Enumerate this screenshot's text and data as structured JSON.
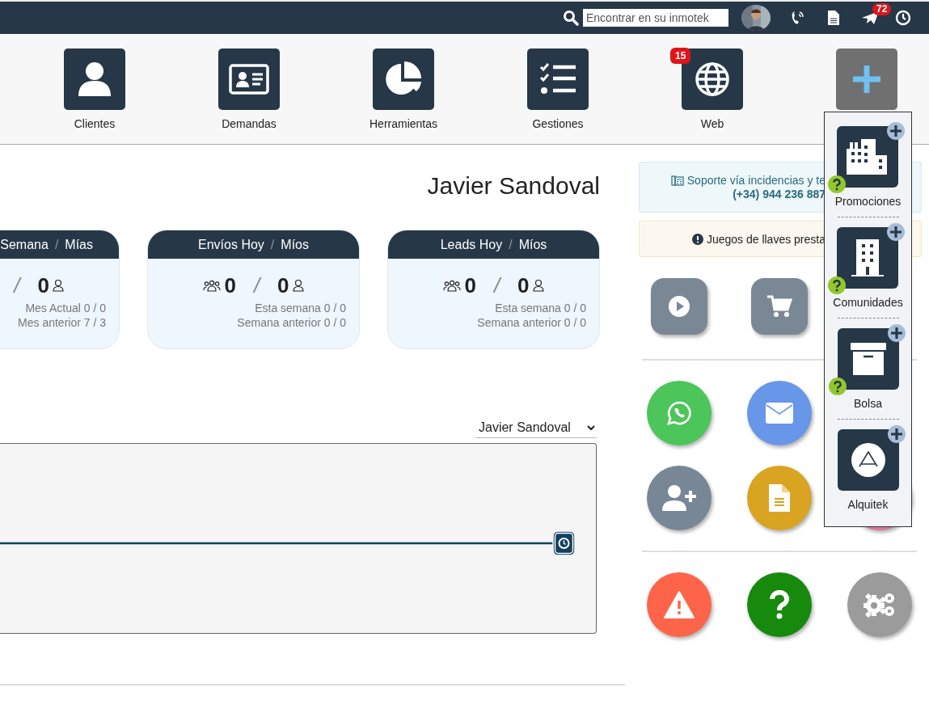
{
  "top_bar": {
    "search": {
      "placeholder": "Encontrar en su inmotek"
    },
    "notification_count": "72"
  },
  "nav": [
    {
      "kind": "clients",
      "label": "Clientes"
    },
    {
      "kind": "demands",
      "label": "Demandas"
    },
    {
      "kind": "tools",
      "label": "Herramientas"
    },
    {
      "kind": "tasks",
      "label": "Gestiones"
    },
    {
      "kind": "web",
      "label": "Web",
      "badge": "15"
    },
    {
      "kind": "add"
    }
  ],
  "user_name": "Javier Sandoval",
  "stats": [
    {
      "title": "Semana",
      "title_separator": "/",
      "subtitle": "Mías",
      "value_separator": "/",
      "mine_value": "0",
      "lines": [
        "Mes Actual 0 / 0",
        "Mes anterior 7 / 3"
      ]
    },
    {
      "title": "Envíos Hoy",
      "title_separator": "/",
      "subtitle": "Míos",
      "group_value": "0",
      "value_separator": "/",
      "mine_value": "0",
      "lines": [
        "Esta semana 0 / 0",
        "Semana anterior 0 / 0"
      ]
    },
    {
      "title": "Leads Hoy",
      "title_separator": "/",
      "subtitle": "Míos",
      "group_value": "0",
      "value_separator": "/",
      "mine_value": "0",
      "lines": [
        "Esta semana 0 / 0",
        "Semana anterior 0 / 0"
      ]
    }
  ],
  "activity": {
    "selector": {
      "value": "Javier Sandoval"
    }
  },
  "support": {
    "text": "Soporte vía incidencias y te",
    "phone": "(+34) 944 236 887"
  },
  "alert": {
    "text": "Juegos de llaves presta"
  },
  "action_rows": [
    {
      "kind": "square",
      "buttons": [
        {
          "kind": "play",
          "color": "#7a8896"
        },
        {
          "kind": "cart",
          "color": "#7a8896"
        }
      ]
    },
    {
      "kind": "circle",
      "buttons": [
        {
          "kind": "whatsapp",
          "color": "#4cc55a"
        },
        {
          "kind": "mail",
          "color": "#6896e8"
        }
      ]
    },
    {
      "kind": "circle",
      "buttons": [
        {
          "kind": "add-user",
          "color": "#788796"
        },
        {
          "kind": "document",
          "color": "#d8a422"
        },
        {
          "kind": "other",
          "color": "#dd7493"
        }
      ]
    },
    {
      "kind": "circle",
      "buttons": [
        {
          "kind": "warning",
          "color": "#fe644a"
        },
        {
          "kind": "help",
          "color": "#178a0e"
        },
        {
          "kind": "settings",
          "color": "#9b9b9b"
        }
      ]
    }
  ],
  "new_menu": [
    {
      "kind": "promotions",
      "label": "Promociones",
      "help": true
    },
    {
      "kind": "communities",
      "label": "Comunidades",
      "help": true
    },
    {
      "kind": "storage",
      "label": "Bolsa",
      "help": true
    },
    {
      "kind": "rental",
      "label": "Alquitek",
      "help": false
    }
  ]
}
